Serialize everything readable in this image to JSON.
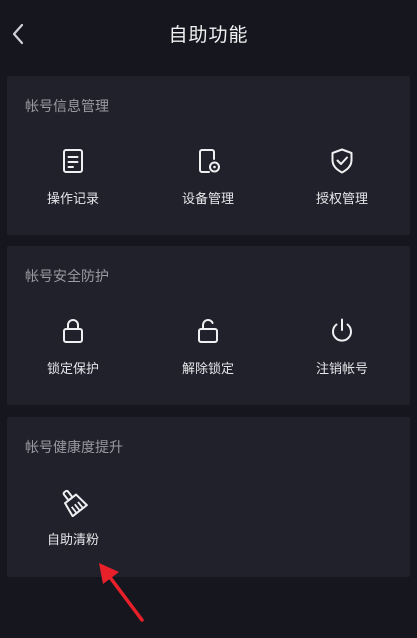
{
  "header": {
    "title": "自助功能"
  },
  "sections": [
    {
      "title": "帐号信息管理",
      "items": [
        {
          "label": "操作记录",
          "icon": "document-icon"
        },
        {
          "label": "设备管理",
          "icon": "device-settings-icon"
        },
        {
          "label": "授权管理",
          "icon": "shield-check-icon"
        }
      ]
    },
    {
      "title": "帐号安全防护",
      "items": [
        {
          "label": "锁定保护",
          "icon": "lock-icon"
        },
        {
          "label": "解除锁定",
          "icon": "unlock-icon"
        },
        {
          "label": "注销帐号",
          "icon": "power-icon"
        }
      ]
    },
    {
      "title": "帐号健康度提升",
      "items": [
        {
          "label": "自助清粉",
          "icon": "broom-icon"
        }
      ]
    }
  ],
  "colors": {
    "background": "#16161e",
    "card": "#21212b",
    "annotation_arrow": "#e8202a"
  }
}
